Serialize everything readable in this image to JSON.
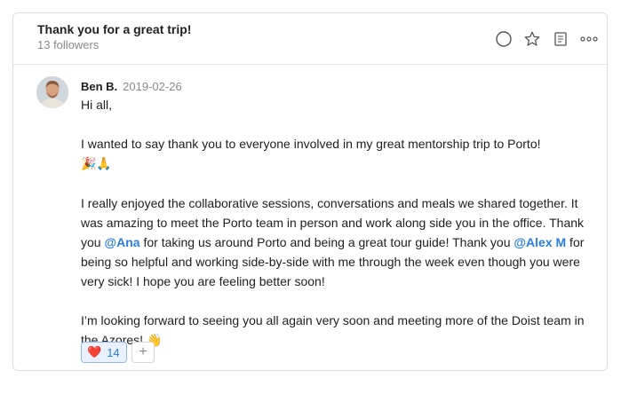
{
  "thread": {
    "title": "Thank you for a great trip!",
    "followers": "13 followers"
  },
  "header_icons": [
    "circle-icon",
    "star-icon",
    "notebook-icon",
    "more-icon"
  ],
  "comment": {
    "author": "Ben B.",
    "date": "2019-02-26",
    "greeting": "Hi all,",
    "para1_text": "I wanted to say thank you to everyone involved in my great mentorship trip to Porto!",
    "para1_emoji": "🎉🙏",
    "para2_a": "I really enjoyed the collaborative sessions, conversations and meals we shared together. It was amazing to meet the Porto team in person and work along side you in the office. Thank you ",
    "mention1": "@Ana",
    "para2_b": " for taking us around Porto and being a great tour guide! Thank you ",
    "mention2": "@Alex M",
    "para2_c": " for being so helpful and working side-by-side with me through the week even though you were very sick! I hope you are feeling better soon!",
    "para3_text": "I’m looking forward to seeing you all again very soon and meeting more of the Doist team in the Azores!",
    "para3_emoji": "👋"
  },
  "reactions": {
    "heart_emoji": "❤️",
    "heart_count": "14",
    "add_label": "+"
  },
  "colors": {
    "mention": "#2b7de1",
    "reaction_border": "#8fb7ee",
    "reaction_bg": "#e8f1fd"
  }
}
